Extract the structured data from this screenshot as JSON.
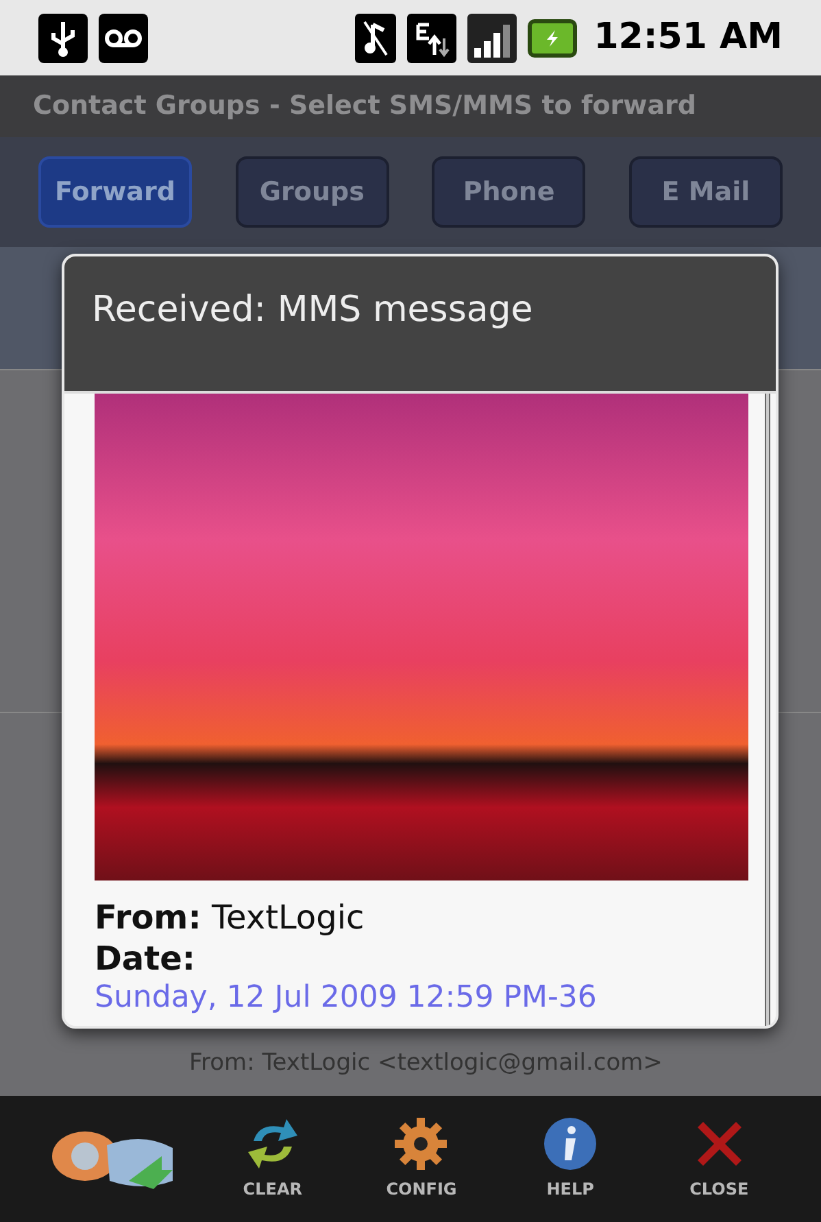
{
  "status_bar": {
    "time": "12:51 AM"
  },
  "title_bar": {
    "title": "Contact Groups - Select SMS/MMS to forward"
  },
  "tabs": [
    {
      "label": "Forward",
      "selected": true
    },
    {
      "label": "Groups",
      "selected": false
    },
    {
      "label": "Phone",
      "selected": false
    },
    {
      "label": "E Mail",
      "selected": false
    }
  ],
  "background_message": {
    "from_line": "From: TextLogic <textlogic@gmail.com>"
  },
  "dialog": {
    "title": "Received: MMS message",
    "from_label": "From:",
    "from_value": "TextLogic",
    "date_label": "Date:",
    "date_value": "Sunday, 12 Jul 2009 12:59 PM-36"
  },
  "toolbar": [
    {
      "kind": "app"
    },
    {
      "kind": "clear",
      "label": "CLEAR"
    },
    {
      "kind": "config",
      "label": "CONFIG"
    },
    {
      "kind": "help",
      "label": "HELP"
    },
    {
      "kind": "close",
      "label": "CLOSE"
    }
  ]
}
